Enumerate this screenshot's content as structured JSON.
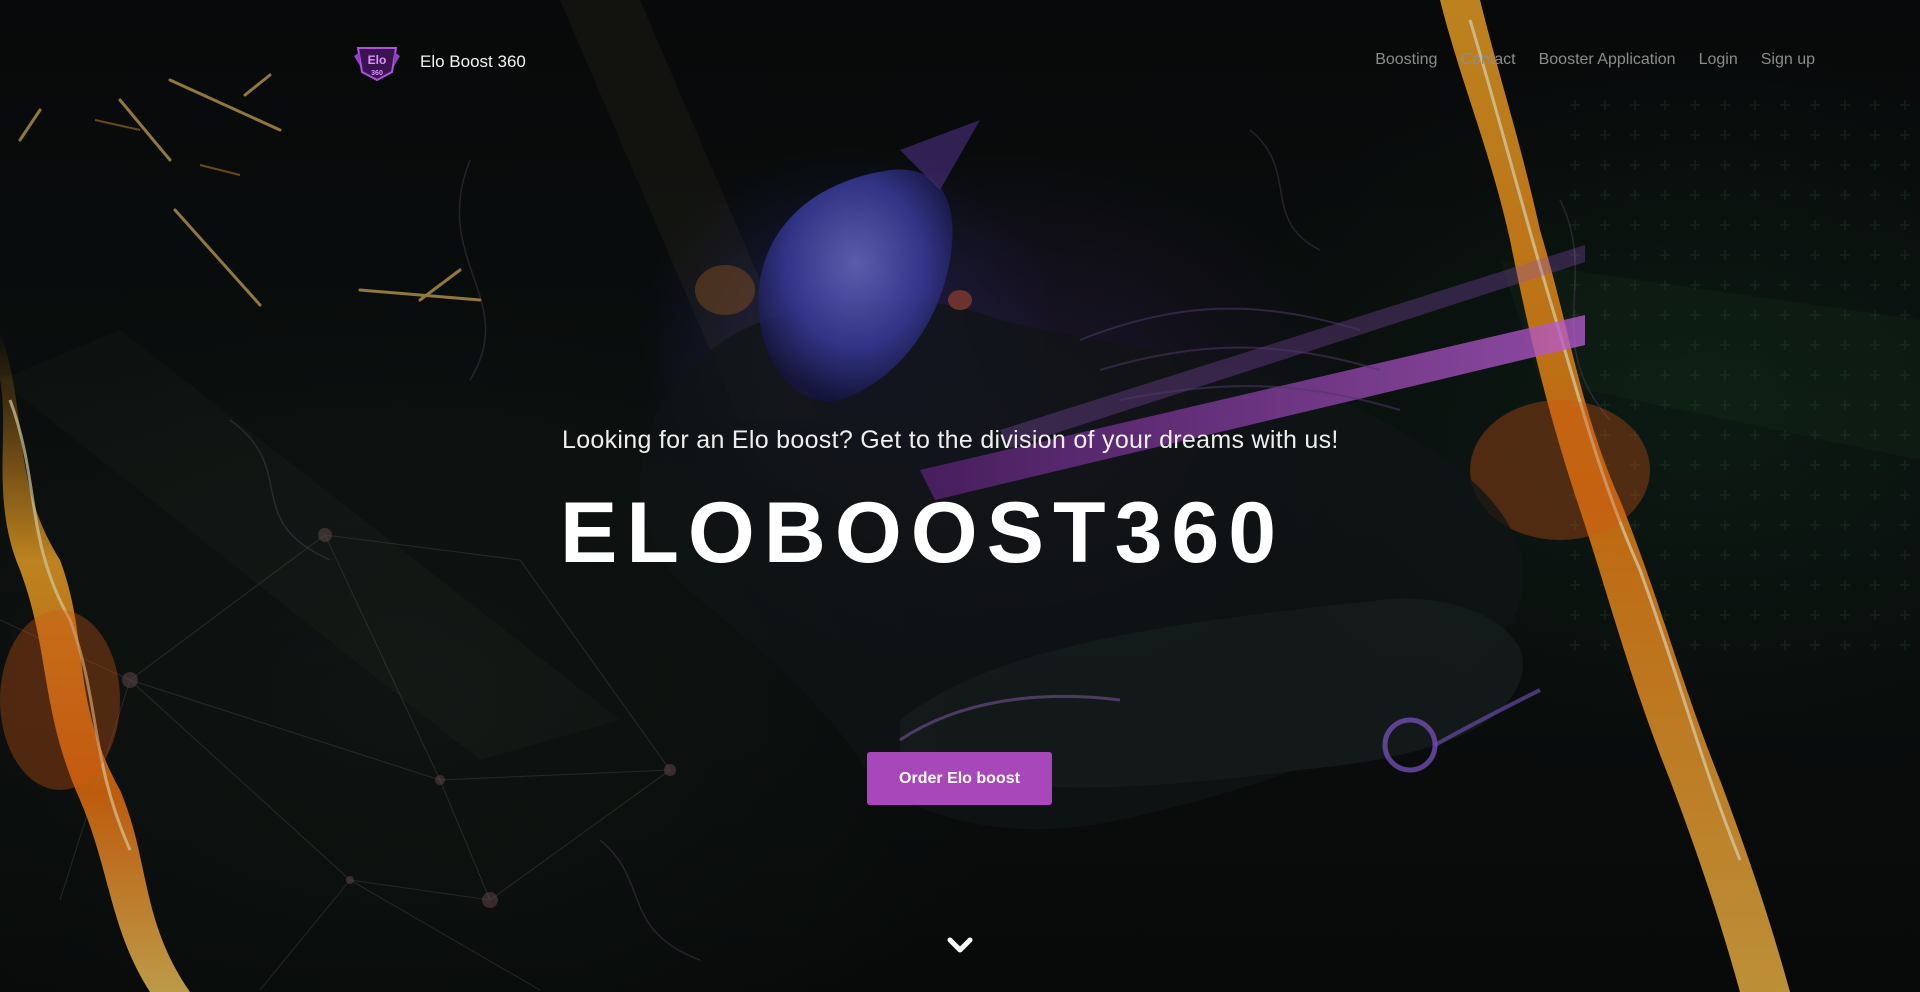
{
  "brand": {
    "name": "Elo Boost 360",
    "logo_text": "Elo",
    "logo_subtext": "360",
    "accent_color": "#a747b9"
  },
  "nav": {
    "items": [
      {
        "label": "Boosting"
      },
      {
        "label": "Contact"
      },
      {
        "label": "Booster Application"
      },
      {
        "label": "Login"
      },
      {
        "label": "Sign up"
      }
    ]
  },
  "hero": {
    "tagline": "Looking for an Elo boost? Get to the division of your dreams with us!",
    "headline": "ELOBOOST360",
    "cta_label": "Order Elo boost",
    "scroll_icon": "chevron-down-icon"
  }
}
